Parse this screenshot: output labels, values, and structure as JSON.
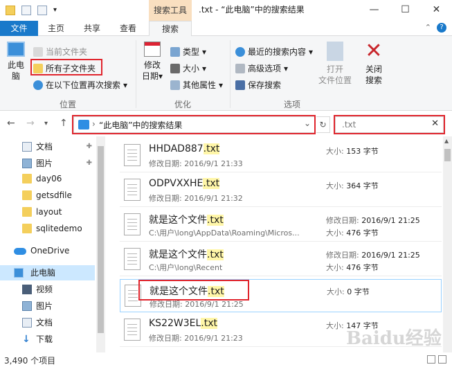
{
  "window": {
    "title": ".txt - “此电脑”中的搜索结果",
    "context_tab": "搜索工具",
    "controls": [
      "—",
      "☐",
      "✕"
    ]
  },
  "tabs": [
    {
      "label": "文件"
    },
    {
      "label": "主页"
    },
    {
      "label": "共享"
    },
    {
      "label": "查看"
    },
    {
      "label": "搜索"
    }
  ],
  "ribbon": {
    "location": {
      "label": "位置",
      "this_pc": "此电脑",
      "this_pc_line1": "此电",
      "this_pc_line2": "脑",
      "current_folder": "当前文件夹",
      "all_subfolders": "所有子文件夹",
      "search_again": "在以下位置再次搜索"
    },
    "refine": {
      "label": "优化",
      "modified_line1": "修改",
      "modified_line2": "日期",
      "type": "类型",
      "size": "大小",
      "other_props": "其他属性"
    },
    "options": {
      "label": "选项",
      "recent_searches": "最近的搜索内容",
      "advanced": "高级选项",
      "save_search": "保存搜索",
      "open_location_line1": "打开",
      "open_location_line2": "文件位置",
      "close_line1": "关闭",
      "close_line2": "搜索"
    }
  },
  "address": {
    "path": "“此电脑”中的搜索结果",
    "search_query": ".txt"
  },
  "nav": [
    {
      "label": "文档",
      "icon": "document-icon"
    },
    {
      "label": "图片",
      "icon": "pictures-icon"
    },
    {
      "label": "day06",
      "icon": "folder-icon"
    },
    {
      "label": "getsdfile",
      "icon": "folder-icon"
    },
    {
      "label": "layout",
      "icon": "folder-icon"
    },
    {
      "label": "sqlitedemo",
      "icon": "folder-icon"
    },
    {
      "label": "OneDrive",
      "icon": "onedrive-icon"
    },
    {
      "label": "此电脑",
      "icon": "computer-icon"
    },
    {
      "label": "视频",
      "icon": "video-icon"
    },
    {
      "label": "图片",
      "icon": "pictures-icon"
    },
    {
      "label": "文档",
      "icon": "document-icon"
    },
    {
      "label": "下载",
      "icon": "download-icon"
    }
  ],
  "results": [
    {
      "base": "HHDAD887",
      "ext": ".txt",
      "sub": "修改日期: 2016/9/1 21:33",
      "r1": "大小: ",
      "r1v": "153 字节",
      "r2": "",
      "r2v": ""
    },
    {
      "base": "ODPVXXHE",
      "ext": ".txt",
      "sub": "修改日期: 2016/9/1 21:32",
      "r1": "大小: ",
      "r1v": "364 字节",
      "r2": "",
      "r2v": ""
    },
    {
      "base": "就是这个文件",
      "ext": ".txt",
      "sub": "C:\\用户\\long\\AppData\\Roaming\\Micros...",
      "r1": "修改日期: ",
      "r1v": "2016/9/1 21:25",
      "r2": "大小: ",
      "r2v": "476 字节"
    },
    {
      "base": "就是这个文件",
      "ext": ".txt",
      "sub": "C:\\用户\\long\\Recent",
      "r1": "修改日期: ",
      "r1v": "2016/9/1 21:25",
      "r2": "大小: ",
      "r2v": "476 字节"
    },
    {
      "base": "就是这个文件",
      "ext": ".txt",
      "sub": "修改日期: 2016/9/1 21:25",
      "r1": "大小: ",
      "r1v": "0 字节",
      "r2": "",
      "r2v": ""
    },
    {
      "base": "KS22W3EL",
      "ext": ".txt",
      "sub": "修改日期: 2016/9/1 21:23",
      "r1": "大小: ",
      "r1v": "147 字节",
      "r2": "",
      "r2v": ""
    }
  ],
  "status": {
    "count": "3,490 个项目"
  },
  "watermark": "Baidu经验",
  "colors": {
    "accent": "#1979ca",
    "highlight": "#e0242c",
    "match": "#fff6a8"
  }
}
